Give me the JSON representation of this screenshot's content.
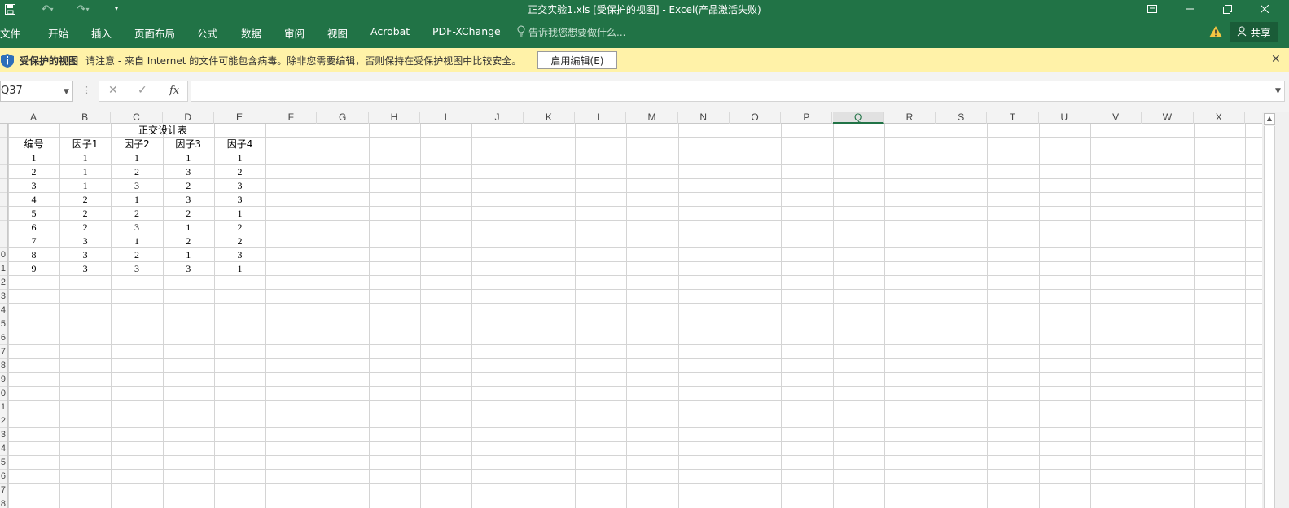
{
  "window": {
    "title": "正交实验1.xls  [受保护的视图] - Excel(产品激活失败)"
  },
  "quick_access": {
    "save_icon": "save-icon",
    "undo_icon": "undo-icon",
    "redo_icon": "redo-icon",
    "customize_icon": "customize-qat-icon"
  },
  "ribbon": {
    "tabs": [
      "文件",
      "开始",
      "插入",
      "页面布局",
      "公式",
      "数据",
      "审阅",
      "视图",
      "Acrobat",
      "PDF-XChange"
    ],
    "tell_me": "告诉我您想要做什么...",
    "share": "共享"
  },
  "protected_view": {
    "title": "受保护的视图",
    "message": "请注意 - 来自 Internet 的文件可能包含病毒。除非您需要编辑，否则保持在受保护视图中比较安全。",
    "enable_button": "启用编辑(E)",
    "close": "✕"
  },
  "formula_bar": {
    "name_box": "Q37",
    "cancel": "✕",
    "enter": "✓",
    "fx": "fx",
    "content": ""
  },
  "sheet": {
    "columns": [
      "A",
      "B",
      "C",
      "D",
      "E",
      "F",
      "G",
      "H",
      "I",
      "J",
      "K",
      "L",
      "M",
      "N",
      "O",
      "P",
      "Q",
      "R",
      "S",
      "T",
      "U",
      "V",
      "W",
      "X"
    ],
    "selected_column": "Q",
    "row_numbers": [
      "",
      "",
      "",
      "",
      "",
      "",
      "",
      "",
      "",
      "0",
      "1",
      "2",
      "3",
      "4",
      "5",
      "6",
      "7",
      "8",
      "9",
      "0",
      "1",
      "2",
      "3",
      "4",
      "5",
      "6",
      "7",
      "8"
    ],
    "table_title": "正交设计表",
    "headers": [
      "编号",
      "因子1",
      "因子2",
      "因子3",
      "因子4"
    ],
    "rows": [
      [
        "1",
        "1",
        "1",
        "1",
        "1"
      ],
      [
        "2",
        "1",
        "2",
        "3",
        "2"
      ],
      [
        "3",
        "1",
        "3",
        "2",
        "3"
      ],
      [
        "4",
        "2",
        "1",
        "3",
        "3"
      ],
      [
        "5",
        "2",
        "2",
        "2",
        "1"
      ],
      [
        "6",
        "2",
        "3",
        "1",
        "2"
      ],
      [
        "7",
        "3",
        "1",
        "2",
        "2"
      ],
      [
        "8",
        "3",
        "2",
        "1",
        "3"
      ],
      [
        "9",
        "3",
        "3",
        "3",
        "1"
      ]
    ]
  }
}
